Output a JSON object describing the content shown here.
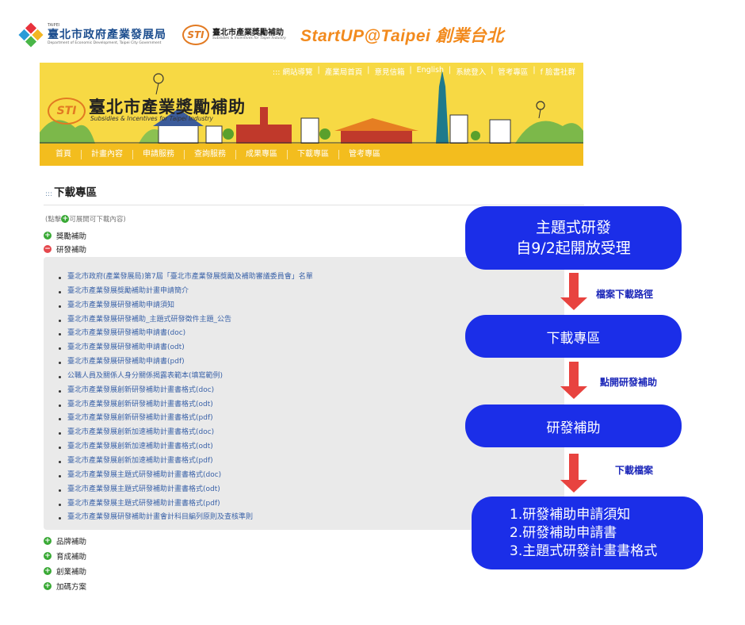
{
  "logos": {
    "gov_small": "TAIPEI",
    "gov_name": "臺北市政府產業發展局",
    "gov_en": "Department of Economic Development, Taipei City Government",
    "sti_mark": "STI",
    "sti_name": "臺北市產業獎勵補助",
    "sti_en": "Subsidies & Incentives for Taipei Industry",
    "startup": "StartUP@Taipei 創業台北"
  },
  "banner": {
    "topnav": [
      "::: 網站導覽",
      "產業局首頁",
      "意見信箱",
      "English",
      "系統登入",
      "管考專區",
      "f 臉書社群"
    ],
    "title": "臺北市產業獎勵補助",
    "subtitle": "Subsidies & Incentives for Taipei Industry",
    "sti_mark": "STI"
  },
  "mainnav": [
    "首頁",
    "計畫內容",
    "申請服務",
    "查詢服務",
    "成果專區",
    "下載專區",
    "管考專區"
  ],
  "page": {
    "title_dots": ":::",
    "title": "下載專區",
    "hint_prefix": "(點擊",
    "hint_suffix": "可展開可下載內容)"
  },
  "categories_top": [
    {
      "label": "獎勵補助",
      "state": "collapsed"
    },
    {
      "label": "研發補助",
      "state": "expanded"
    }
  ],
  "documents": [
    "臺北市政府(產業發展局)第7屆「臺北市產業發展獎勵及補助審議委員會」名單",
    "臺北市產業發展獎勵補助計畫申請簡介",
    "臺北市產業發展研發補助申請須知",
    "臺北市產業發展研發補助_主題式研發徵件主題_公告",
    "臺北市產業發展研發補助申請書(doc)",
    "臺北市產業發展研發補助申請書(odt)",
    "臺北市產業發展研發補助申請書(pdf)",
    "公職人員及關係人身分關係揭露表範本(填寫範例)",
    "臺北市產業發展創新研發補助計畫書格式(doc)",
    "臺北市產業發展創新研發補助計畫書格式(odt)",
    "臺北市產業發展創新研發補助計畫書格式(pdf)",
    "臺北市產業發展創新加速補助計畫書格式(doc)",
    "臺北市產業發展創新加速補助計畫書格式(odt)",
    "臺北市產業發展創新加速補助計畫書格式(pdf)",
    "臺北市產業發展主題式研發補助計畫書格式(doc)",
    "臺北市產業發展主題式研發補助計畫書格式(odt)",
    "臺北市產業發展主題式研發補助計畫書格式(pdf)",
    "臺北市產業發展研發補助計畫會計科目編列原則及查核準則"
  ],
  "categories_bottom": [
    "品牌補助",
    "育成補助",
    "創業補助",
    "加碼方案"
  ],
  "flow": {
    "box1_line1": "主題式研發",
    "box1_line2": "自9/2起開放受理",
    "label1": "檔案下載路徑",
    "box2": "下載專區",
    "label2": "點開研發補助",
    "box3": "研發補助",
    "label3": "下載檔案",
    "box4": [
      "1.研發補助申請須知",
      "2.研發補助申請書",
      "3.主題式研發計畫書格式"
    ]
  },
  "colors": {
    "banner_yellow": "#f7d944",
    "nav_yellow": "#f3bd1e",
    "flow_blue": "#1b2ee8",
    "arrow_red": "#e8433f",
    "link_blue": "#3a62a8"
  }
}
